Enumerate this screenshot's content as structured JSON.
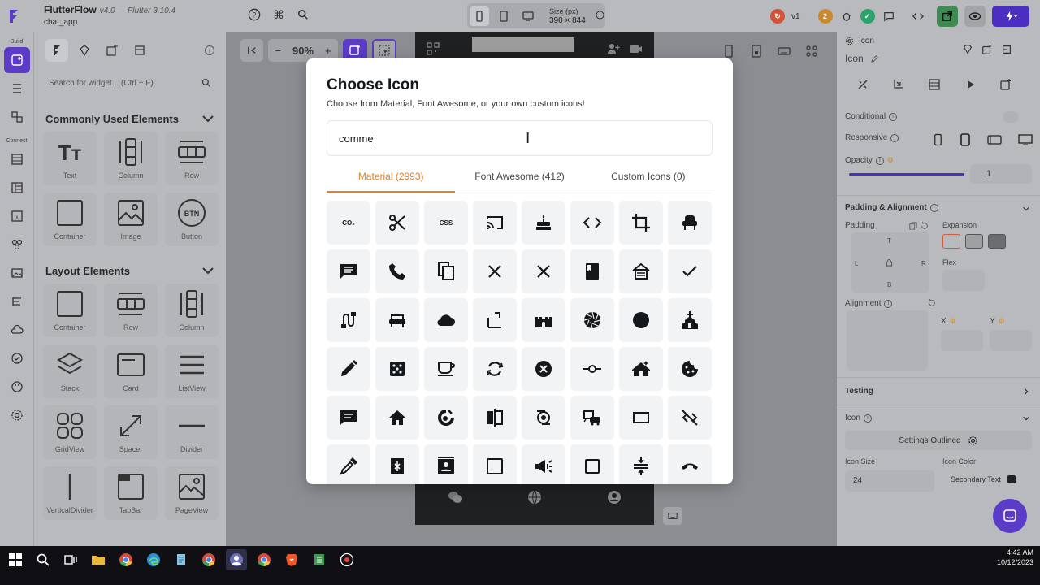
{
  "app": {
    "name": "FlutterFlow",
    "version": "v4.0",
    "flutter": "— Flutter 3.10.4",
    "project": "chat_app"
  },
  "topbar": {
    "size_label": "Size (px)",
    "size_value": "390 × 844",
    "version_badge": "v1",
    "badge_count": "2"
  },
  "rail": {
    "build_label": "Build",
    "connect_label": "Connect"
  },
  "widget_panel": {
    "search_placeholder": "Search for widget... (Ctrl + F)",
    "sections": [
      {
        "title": "Commonly Used Elements",
        "items": [
          "Text",
          "Column",
          "Row",
          "Container",
          "Image",
          "Button"
        ]
      },
      {
        "title": "Layout Elements",
        "items": [
          "Container",
          "Row",
          "Column",
          "Stack",
          "Card",
          "ListView",
          "GridView",
          "Spacer",
          "Divider",
          "VerticalDivider",
          "TabBar",
          "PageView"
        ]
      }
    ]
  },
  "canvas": {
    "zoom": "90%"
  },
  "modal": {
    "title": "Choose Icon",
    "subtitle": "Choose from Material, Font Awesome, or your own custom icons!",
    "search_value": "comme",
    "tabs": [
      "Material (2993)",
      "Font Awesome (412)",
      "Custom Icons (0)"
    ],
    "active_tab": 0,
    "icons": [
      "co2-icon",
      "content-cut-icon",
      "css-icon",
      "cast-icon",
      "cake-icon",
      "code-icon",
      "crop-icon",
      "chair-icon",
      "comment-icon",
      "call-icon",
      "content-copy-icon",
      "close-icon",
      "clear-icon",
      "class-icon",
      "cottage-icon",
      "check-icon",
      "cable-icon",
      "chair-alt-icon",
      "cloud-icon",
      "crop-free-icon",
      "castle-icon",
      "camera-icon",
      "circle-icon",
      "church-icon",
      "create-icon",
      "casino-icon",
      "coffee-icon",
      "cached-icon",
      "cancel-icon",
      "commit-icon",
      "cabin-icon",
      "cookie-icon",
      "chat-icon",
      "home-icon",
      "cruelty-free-icon",
      "compare-icon",
      "cyclone-icon",
      "commute-icon",
      "crop-landscape-icon",
      "code-off-icon",
      "colorize-icon",
      "compress-icon",
      "contact-mail-icon",
      "check-box-outline-icon",
      "campaign-icon",
      "crop-square-icon",
      "compress-vertical-icon",
      "call-end-icon"
    ]
  },
  "props": {
    "widget_type": "Icon",
    "widget_name": "Icon",
    "conditional_label": "Conditional",
    "responsive_label": "Responsive",
    "opacity_label": "Opacity",
    "opacity_value": "1",
    "padding_alignment_label": "Padding & Alignment",
    "padding_label": "Padding",
    "expansion_label": "Expansion",
    "flex_label": "Flex",
    "alignment_label": "Alignment",
    "pad_t": "T",
    "pad_l": "L",
    "pad_r": "R",
    "pad_b": "B",
    "x_label": "X",
    "y_label": "Y",
    "testing_label": "Testing",
    "icon_section_label": "Icon",
    "icon_value": "Settings Outlined",
    "icon_size_label": "Icon Size",
    "icon_size_value": "24",
    "icon_color_label": "Icon Color",
    "icon_color_value": "Secondary Text"
  },
  "taskbar": {
    "time": "4:42 AM",
    "date": "10/12/2023"
  },
  "colors": {
    "accent": "#e0822f",
    "brand": "#5a3cc6",
    "icon_bg": "#f1f3f5"
  }
}
